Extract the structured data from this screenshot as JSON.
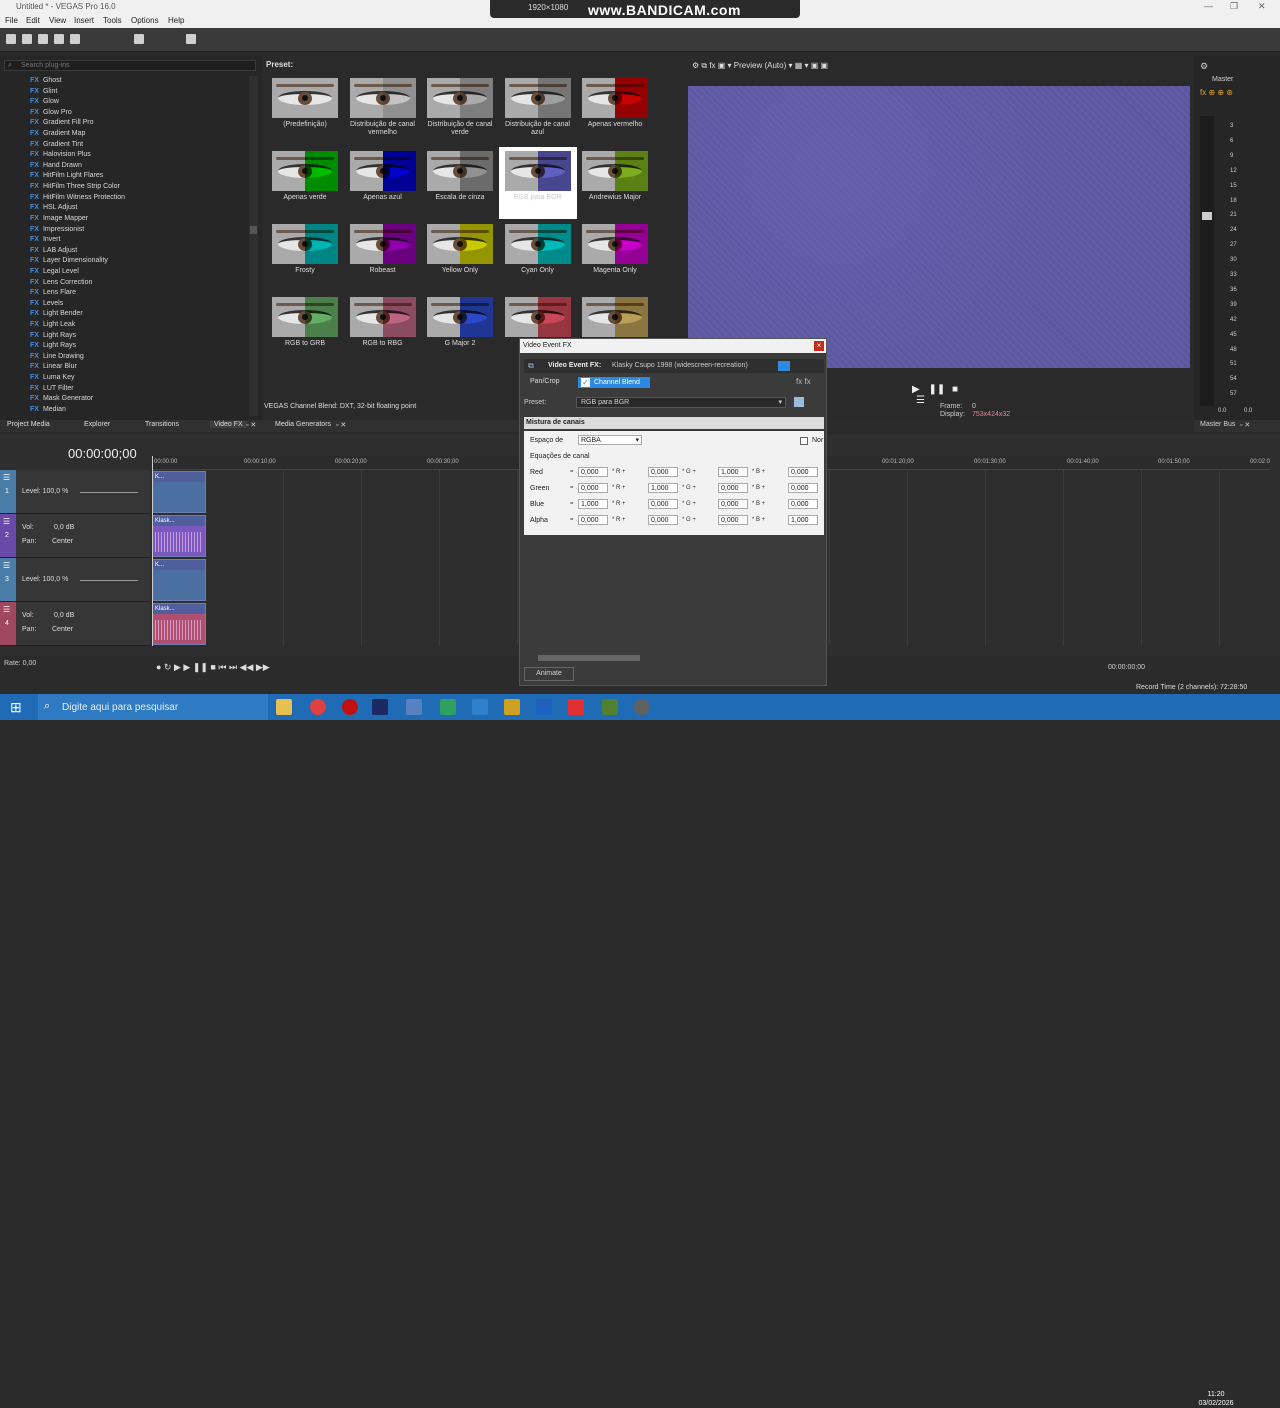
{
  "window": {
    "title": "Untitled * - VEGAS Pro 16.0"
  },
  "menu": [
    "File",
    "Edit",
    "View",
    "Insert",
    "Tools",
    "Options",
    "Help"
  ],
  "bandicam": {
    "resolution": "1920×1080",
    "logo": "www.BANDICAM.com"
  },
  "plugins": {
    "search_placeholder": "Search plug-ins",
    "items": [
      "Ghost",
      "Glint",
      "Glow",
      "Glow Pro",
      "Gradient Fill Pro",
      "Gradient Map",
      "Gradient Tint",
      "Halovision Plus",
      "Hand Drawn",
      "HitFilm Light Flares",
      "HitFilm Three Strip Color",
      "HitFilm Witness Protection",
      "HSL Adjust",
      "Image Mapper",
      "Impressionist",
      "Invert",
      "LAB Adjust",
      "Layer Dimensionality",
      "Legal Level",
      "Lens Correction",
      "Lens Flare",
      "Levels",
      "Light Bender",
      "Light Leak",
      "Light Rays",
      "Light Rays",
      "Line Drawing",
      "Linear Blur",
      "Luma Key",
      "LUT Filter",
      "Mask Generator",
      "Median"
    ]
  },
  "presets": {
    "header": "Preset:",
    "items": [
      {
        "label": "(Predefinição)",
        "tint": "none"
      },
      {
        "label": "Distribuição de canal vermelho",
        "tint": "#d8d8d8"
      },
      {
        "label": "Distribuição de canal verde",
        "tint": "#bdbdbd"
      },
      {
        "label": "Distribuição de canal azul",
        "tint": "#b0b0b0"
      },
      {
        "label": "Apenas vermelho",
        "tint": "#e00000"
      },
      {
        "label": "Apenas verde",
        "tint": "#00d000"
      },
      {
        "label": "Apenas azul",
        "tint": "#0000e0"
      },
      {
        "label": "Escala de cinza",
        "tint": "#a0a0a0"
      },
      {
        "label": "RGB para BGR",
        "tint": "#6a6ad8",
        "selected": true
      },
      {
        "label": "Andrewius Major",
        "tint": "#88c020"
      },
      {
        "label": "Frosty",
        "tint": "#00c8c8"
      },
      {
        "label": "Robeast",
        "tint": "#a000c0"
      },
      {
        "label": "Yellow Only",
        "tint": "#e0e000"
      },
      {
        "label": "Cyan Only",
        "tint": "#00d0d0"
      },
      {
        "label": "Magenta Only",
        "tint": "#e000e0"
      },
      {
        "label": "RGB to GRB",
        "tint": "#70c070"
      },
      {
        "label": "RGB to RBG",
        "tint": "#d07090"
      },
      {
        "label": "G Major 2",
        "tint": "#3050e0"
      },
      {
        "label": "",
        "tint": "#e05060"
      },
      {
        "label": "",
        "tint": "#d0b060"
      }
    ],
    "status": "VEGAS Channel Blend: DXT, 32-bit floating point"
  },
  "preview": {
    "mode": "Preview (Auto)",
    "frame_label": "Frame:",
    "frame_value": "0",
    "display_label": "Display:",
    "display_value": "753x424x32",
    "color": "#5c57a0"
  },
  "master": {
    "label": "Master",
    "ticks": [
      "3",
      "6",
      "9",
      "12",
      "15",
      "18",
      "21",
      "24",
      "27",
      "30",
      "33",
      "36",
      "39",
      "42",
      "45",
      "48",
      "51",
      "54",
      "57"
    ],
    "bottom": [
      "0.0",
      "0.0"
    ]
  },
  "tabs": [
    "Project Media",
    "Explorer",
    "Transitions",
    "Video FX",
    "Media Generators"
  ],
  "master_bus_tab": "Master Bus",
  "timeline": {
    "timecode": "00:00:00;00",
    "ruler": [
      "00:00:00",
      "00:00:10;00",
      "00:00:20;00",
      "00:00:30;00",
      "00:01:20;00",
      "00:01:30;00",
      "00:01:40;00",
      "00:01:50;00",
      "00:02:0"
    ],
    "tracks": [
      {
        "type": "video",
        "level": "Level: 100,0 %",
        "clip": "K...",
        "color": "#4a7ea8",
        "lanecolor": "#4a6fa0"
      },
      {
        "type": "audio",
        "vol": "Vol:",
        "vol_val": "0,0 dB",
        "pan": "Pan:",
        "pan_val": "Center",
        "clip": "Klask...",
        "color": "#6a4aa8",
        "lanecolor": "#7a58c0"
      },
      {
        "type": "video",
        "level": "Level: 100,0 %",
        "clip": "K...",
        "color": "#4a7ea8",
        "lanecolor": "#4a6fa0"
      },
      {
        "type": "audio",
        "vol": "Vol:",
        "vol_val": "0,0 dB",
        "pan": "Pan:",
        "pan_val": "Center",
        "clip": "Klask...",
        "color": "#a04860",
        "lanecolor": "#b05070"
      }
    ],
    "rate": "Rate: 0,00",
    "end_time": "00:00:00;00",
    "record_time": "Record Time (2 channels): 72:28:50"
  },
  "dialog": {
    "title": "Video Event FX",
    "header_label": "Video Event FX:",
    "header_value": "Klasky Csupo 1998 (widescreen-recreation)",
    "chain_pan": "Pan/Crop",
    "chain_blend": "Channel Blend",
    "preset_label": "Preset:",
    "preset_value": "RGB para BGR",
    "section": "Mistura de canais",
    "space_label": "Espaço de",
    "space_value": "RGBA",
    "norm": "Nor",
    "equations_label": "Equações de canal",
    "rows": [
      {
        "name": "Red",
        "v": [
          "0,000",
          "0,000",
          "1,000",
          "0,000"
        ]
      },
      {
        "name": "Green",
        "v": [
          "0,000",
          "1,000",
          "0,000",
          "0,000"
        ]
      },
      {
        "name": "Blue",
        "v": [
          "1,000",
          "0,000",
          "0,000",
          "0,000"
        ]
      },
      {
        "name": "Alpha",
        "v": [
          "0,000",
          "0,000",
          "0,000",
          "1,000"
        ]
      }
    ],
    "ops": [
      "* R +",
      "* G +",
      "* B +"
    ],
    "animate": "Animate"
  },
  "taskbar": {
    "search": "Digite aqui para pesquisar",
    "time": "11:20",
    "date": "03/02/2026"
  }
}
